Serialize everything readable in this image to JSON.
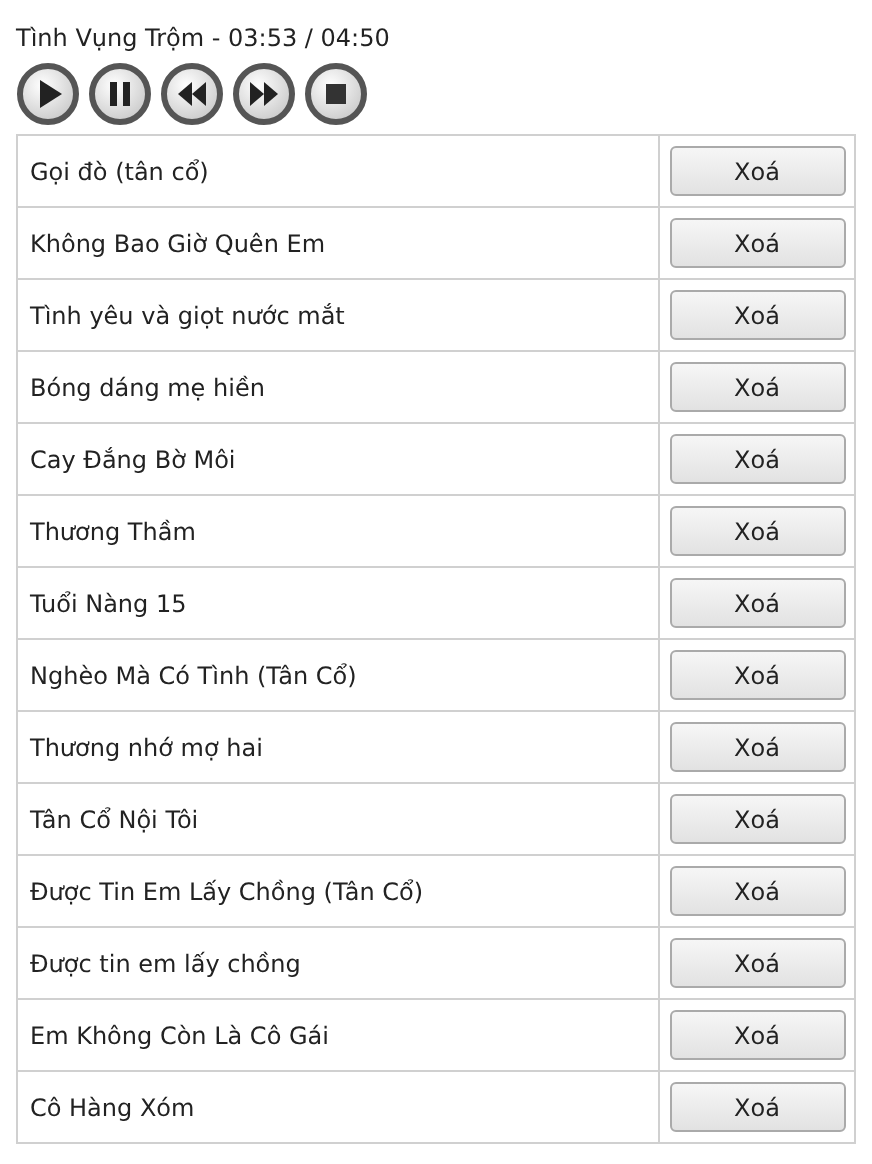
{
  "now_playing": "Tình Vụng Trộm - 03:53 / 04:50",
  "controls": [
    {
      "kind": "play"
    },
    {
      "kind": "pause"
    },
    {
      "kind": "rewind"
    },
    {
      "kind": "forward"
    },
    {
      "kind": "stop"
    }
  ],
  "playlist": [
    {
      "title": "Gọi đò (tân cổ)",
      "action": "Xoá"
    },
    {
      "title": "Không Bao Giờ Quên Em",
      "action": "Xoá"
    },
    {
      "title": "Tình yêu và giọt nước mắt",
      "action": "Xoá"
    },
    {
      "title": "Bóng dáng mẹ hiền",
      "action": "Xoá"
    },
    {
      "title": "Cay Đắng Bờ Môi",
      "action": "Xoá"
    },
    {
      "title": "Thương Thầm",
      "action": "Xoá"
    },
    {
      "title": "Tuổi Nàng 15",
      "action": "Xoá"
    },
    {
      "title": "Nghèo Mà Có Tình (Tân Cổ)",
      "action": "Xoá"
    },
    {
      "title": "Thương nhớ mợ hai",
      "action": "Xoá"
    },
    {
      "title": "Tân Cổ Nội Tôi",
      "action": "Xoá"
    },
    {
      "title": "Được Tin Em Lấy Chồng (Tân Cổ)",
      "action": "Xoá"
    },
    {
      "title": "Được tin em lấy chồng",
      "action": "Xoá"
    },
    {
      "title": "Em Không Còn Là Cô Gái",
      "action": "Xoá"
    },
    {
      "title": "Cô Hàng Xóm",
      "action": "Xoá"
    }
  ]
}
